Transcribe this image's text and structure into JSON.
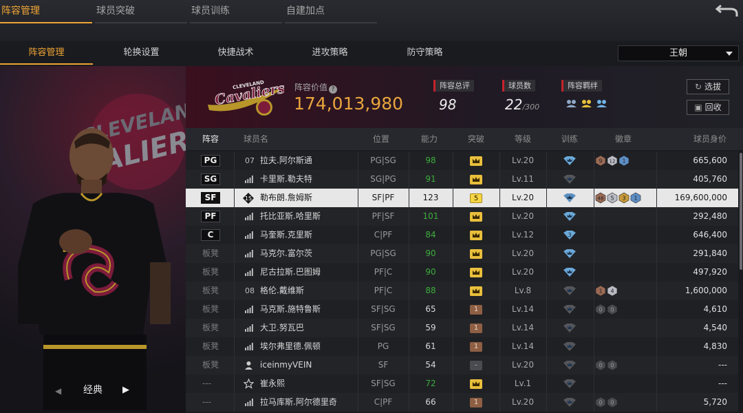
{
  "top_tabs": [
    "阵容管理",
    "球员突破",
    "球员训练",
    "自建加点"
  ],
  "sub_tabs": [
    "阵容管理",
    "轮换设置",
    "快捷战术",
    "进攻策略",
    "防守策略"
  ],
  "tactic_select": "王朝",
  "left": {
    "style_label": "经典",
    "prev_arrow": "◀",
    "next_arrow": "▶"
  },
  "header": {
    "value_label": "阵容价值",
    "value": "174,013,980",
    "overall_label": "阵容总评",
    "overall": "98",
    "count_label": "球员数",
    "count": "22",
    "count_max": "/300",
    "synergy_label": "阵容羁绊",
    "pick_button": "选拔",
    "recycle_button": "回收"
  },
  "columns": [
    "阵容",
    "球员名",
    "位置",
    "能力",
    "突破",
    "等级",
    "训练",
    "徽章",
    "球员身价"
  ],
  "rows": [
    {
      "role": "PG",
      "num": "07",
      "name": "拉夫.阿尔斯通",
      "pos": "PG|SG",
      "rating": "98",
      "green": true,
      "brk": "crown",
      "level": "Lv.20",
      "train": "blue",
      "badges": [
        "9",
        "12",
        "1"
      ],
      "price": "665,600"
    },
    {
      "role": "SG",
      "num": "",
      "name": "卡里斯.勒夫特",
      "pos": "SG|PG",
      "rating": "91",
      "green": true,
      "brk": "crown",
      "level": "Lv.11",
      "train": "gray",
      "badges": [],
      "price": "405,760"
    },
    {
      "role": "SF",
      "num": "15",
      "name": "勒布朗.詹姆斯",
      "pos": "SF|PF",
      "rating": "123",
      "green": false,
      "brk": "5",
      "level": "Lv.20",
      "train": "blue",
      "badges": [
        "48",
        "5",
        "3",
        "1"
      ],
      "price": "169,600,000"
    },
    {
      "role": "PF",
      "num": "",
      "name": "托比亚斯.哈里斯",
      "pos": "PF|SF",
      "rating": "101",
      "green": true,
      "brk": "crown",
      "level": "Lv.20",
      "train": "blue",
      "badges": [],
      "price": "292,480"
    },
    {
      "role": "C",
      "num": "",
      "name": "马奎斯.克里斯",
      "pos": "C|PF",
      "rating": "84",
      "green": true,
      "brk": "crown",
      "level": "Lv.12",
      "train": "blue3",
      "badges": [],
      "price": "646,400"
    },
    {
      "role": "板凳",
      "num": "",
      "name": "马克尔.富尔茨",
      "pos": "PG|SG",
      "rating": "90",
      "green": true,
      "brk": "crown",
      "level": "Lv.20",
      "train": "blue",
      "badges": [],
      "price": "291,840"
    },
    {
      "role": "板凳",
      "num": "",
      "name": "尼古拉斯.巴图姆",
      "pos": "PF|C",
      "rating": "90",
      "green": true,
      "brk": "crown",
      "level": "Lv.20",
      "train": "blue",
      "badges": [],
      "price": "497,920"
    },
    {
      "role": "板凳",
      "num": "08",
      "name": "格伦.戴维斯",
      "pos": "PF|C",
      "rating": "88",
      "green": true,
      "brk": "crown",
      "level": "Lv.8",
      "train": "gray",
      "badges": [
        "1",
        "4"
      ],
      "price": "1,600,000"
    },
    {
      "role": "板凳",
      "num": "",
      "name": "马克斯.施特鲁斯",
      "pos": "SF|SG",
      "rating": "65",
      "green": false,
      "brk": "1",
      "level": "Lv.14",
      "train": "gray",
      "badges": [
        "0",
        "0"
      ],
      "price": "4,610"
    },
    {
      "role": "板凳",
      "num": "",
      "name": "大卫.努瓦巴",
      "pos": "SF|SG",
      "rating": "59",
      "green": false,
      "brk": "1",
      "level": "Lv.14",
      "train": "gray",
      "badges": [],
      "price": "4,540"
    },
    {
      "role": "板凳",
      "num": "",
      "name": "埃尔弗里德.佩顿",
      "pos": "PG",
      "rating": "61",
      "green": false,
      "brk": "1",
      "level": "Lv.14",
      "train": "gray",
      "badges": [],
      "price": "4,830"
    },
    {
      "role": "板凳",
      "num": "",
      "name": "iceinmyVEIN",
      "pos": "SF",
      "rating": "54",
      "green": false,
      "brk": "none",
      "level": "Lv.20",
      "train": "gray",
      "badges": [
        "0",
        "0"
      ],
      "price": "---"
    },
    {
      "role": "---",
      "num": "",
      "name": "崔永熙",
      "pos": "SF|SG",
      "rating": "72",
      "green": true,
      "brk": "crown",
      "level": "Lv.1",
      "train": "gray",
      "badges": [],
      "price": "---"
    },
    {
      "role": "---",
      "num": "",
      "name": "拉马库斯.阿尔德里奇",
      "pos": "C|PF",
      "rating": "66",
      "green": false,
      "brk": "1",
      "level": "Lv.20",
      "train": "gray",
      "badges": [
        "0",
        "0"
      ],
      "price": "5,720"
    }
  ],
  "colors": {
    "accent": "#f0a534",
    "value": "#e9a53d",
    "green": "#3cae3c",
    "crown": "#e9bf3c",
    "red": "#c8222b"
  }
}
